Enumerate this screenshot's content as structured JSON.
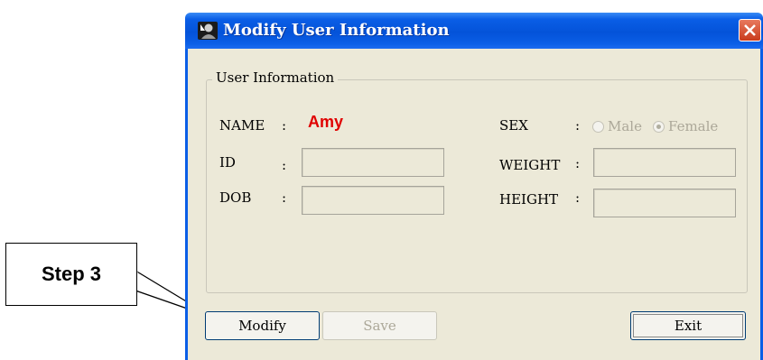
{
  "callout": {
    "label": "Step 3"
  },
  "window": {
    "title": "Modify User Information",
    "group_label": "User Information"
  },
  "fields": {
    "name_label": "NAME",
    "name_value": "Amy",
    "id_label": "ID",
    "dob_label": "DOB",
    "sex_label": "SEX",
    "weight_label": "WEIGHT",
    "height_label": "HEIGHT",
    "colon": ":",
    "id_value": "",
    "dob_value": "",
    "weight_value": "",
    "height_value": ""
  },
  "sex_options": {
    "male": "Male",
    "female": "Female",
    "selected": "Female"
  },
  "buttons": {
    "modify": "Modify",
    "save": "Save",
    "exit": "Exit"
  },
  "colors": {
    "name_value": "#e00000",
    "titlebar": "#0453d9",
    "close_button": "#c93b1c"
  },
  "icons": {
    "title_icon": "user-avatar-icon",
    "close_icon": "close-icon"
  }
}
